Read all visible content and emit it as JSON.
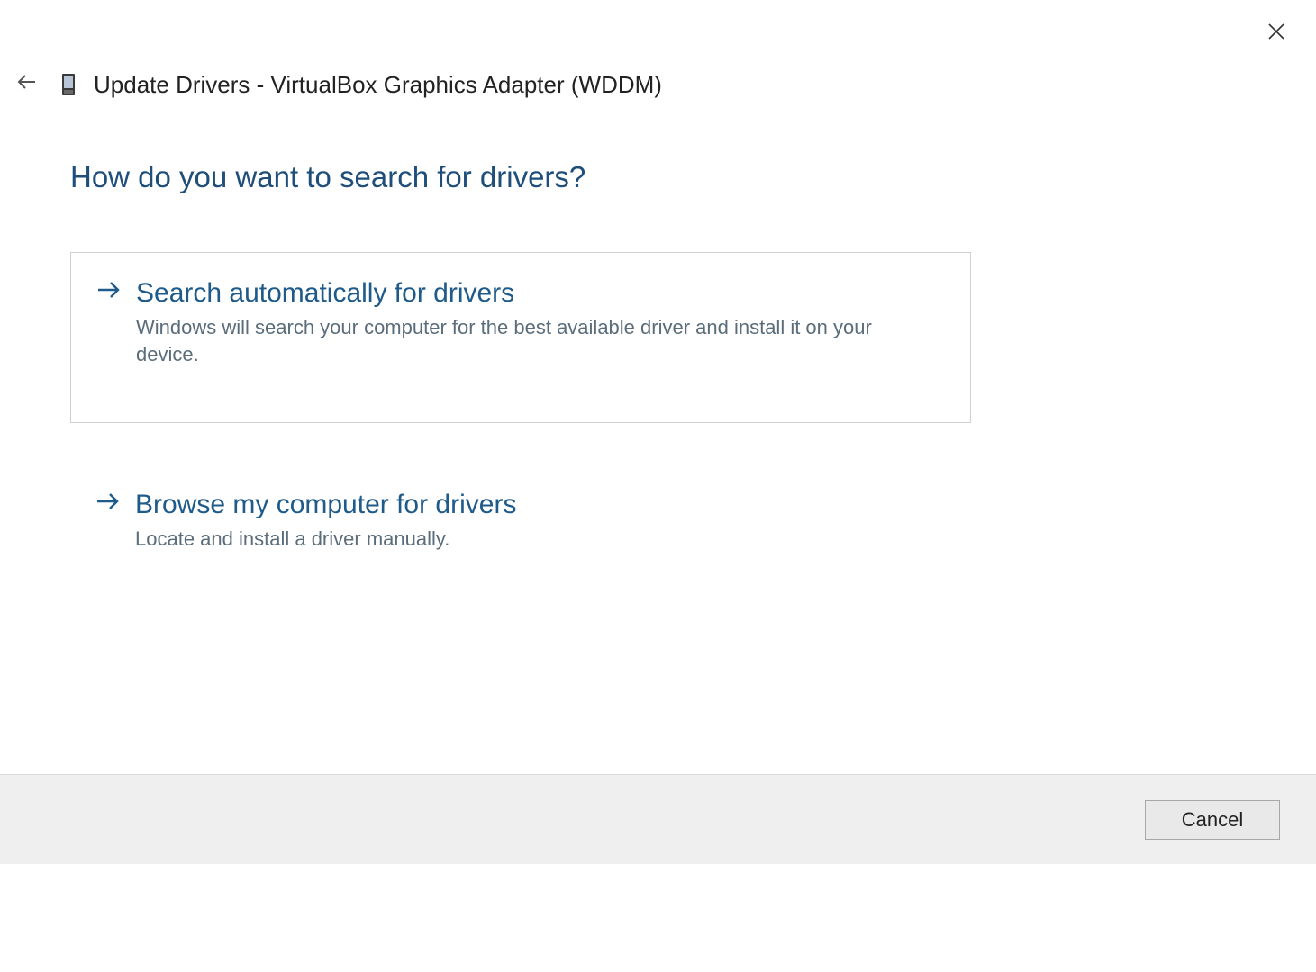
{
  "window": {
    "title": "Update Drivers - VirtualBox Graphics Adapter (WDDM)"
  },
  "main": {
    "prompt": "How do you want to search for drivers?",
    "options": [
      {
        "title": "Search automatically for drivers",
        "description": "Windows will search your computer for the best available driver and install it on your device."
      },
      {
        "title": "Browse my computer for drivers",
        "description": "Locate and install a driver manually."
      }
    ]
  },
  "footer": {
    "cancel_label": "Cancel"
  }
}
